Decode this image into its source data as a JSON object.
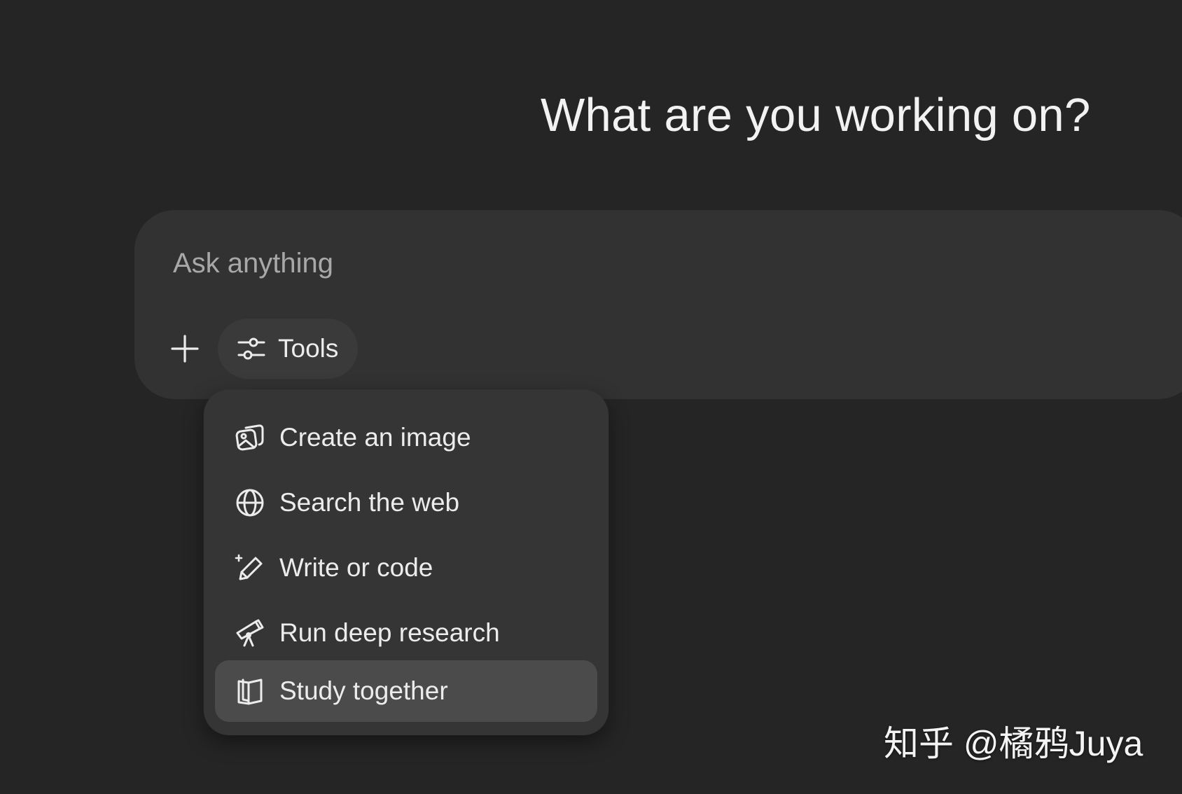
{
  "main": {
    "heading": "What are you working on?"
  },
  "composer": {
    "placeholder": "Ask anything",
    "plus_icon": "plus-icon",
    "tools_label": "Tools",
    "tools_icon": "sliders-icon"
  },
  "tools_menu": {
    "items": [
      {
        "label": "Create an image",
        "icon": "image-icon",
        "active": false
      },
      {
        "label": "Search the web",
        "icon": "globe-icon",
        "active": false
      },
      {
        "label": "Write or code",
        "icon": "pencil-sparkle-icon",
        "active": false
      },
      {
        "label": "Run deep research",
        "icon": "telescope-icon",
        "active": false
      },
      {
        "label": "Study together",
        "icon": "book-icon",
        "active": true
      }
    ]
  },
  "watermark": {
    "text": "知乎 @橘鸦Juya"
  },
  "colors": {
    "background": "#252525",
    "composer": "#323232",
    "menu": "#353535",
    "menu_active": "#4b4b4b",
    "text": "#ececec",
    "placeholder": "#a8a8a8"
  }
}
